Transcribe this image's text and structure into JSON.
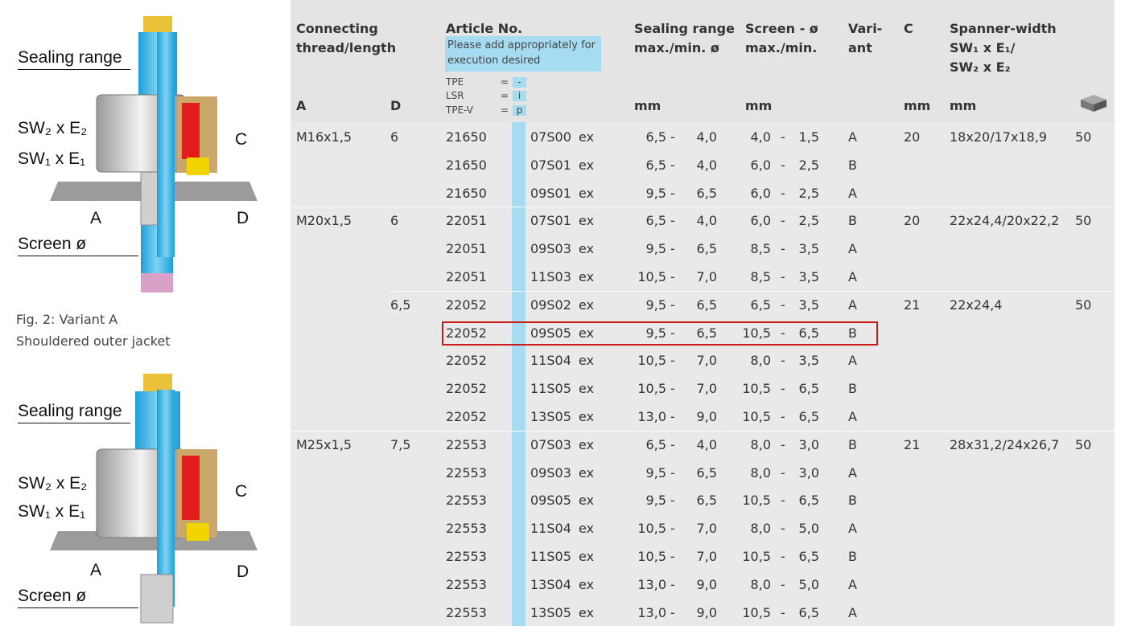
{
  "figure_labels": {
    "sealing_range": "Sealing range",
    "sw2": "SW₂ x E₂",
    "sw1": "SW₁ x E₁",
    "c": "C",
    "d": "D",
    "a": "A",
    "screen": "Screen ø"
  },
  "caption": {
    "line1": "Fig. 2: Variant A",
    "line2": "Shouldered outer jacket"
  },
  "colors": {
    "accent_blue": "#a6dcf2",
    "highlight_red": "#cc1a1a"
  },
  "table": {
    "headers": {
      "connecting": [
        "Connecting",
        "thread/length"
      ],
      "article": "Article No.",
      "note": "Please add appropriately for execution desired",
      "codes": [
        {
          "name": "TPE",
          "eq": "=",
          "val": "-"
        },
        {
          "name": "LSR",
          "eq": "=",
          "val": "i"
        },
        {
          "name": "TPE-V",
          "eq": "=",
          "val": "p"
        }
      ],
      "sealing": [
        "Sealing range",
        "max./min. ø"
      ],
      "screen": [
        "Screen - ø",
        "max./min."
      ],
      "variant": [
        "Vari-",
        "ant"
      ],
      "c": "C",
      "spanner": [
        "Spanner-width",
        "SW₁ x E₁/",
        "SW₂ x E₂"
      ],
      "sub_a": "A",
      "sub_d": "D",
      "sub_mm1": "mm",
      "sub_mm2": "mm",
      "sub_mm3": "mm",
      "sub_mm4": "mm",
      "pack_icon": "package-icon"
    },
    "rows": [
      {
        "a": "M16x1,5",
        "d": "6",
        "art": "21650",
        "code": "07S00",
        "ex": "ex",
        "smax": "6,5",
        "smin": "4,0",
        "rmax": "4,0",
        "rmin": "1,5",
        "var": "A",
        "c": "20",
        "sw": "18x20/17x18,9",
        "qty": "50"
      },
      {
        "a": "",
        "d": "",
        "art": "21650",
        "code": "07S01",
        "ex": "ex",
        "smax": "6,5",
        "smin": "4,0",
        "rmax": "6,0",
        "rmin": "2,5",
        "var": "B",
        "c": "",
        "sw": "",
        "qty": ""
      },
      {
        "a": "",
        "d": "",
        "art": "21650",
        "code": "09S01",
        "ex": "ex",
        "smax": "9,5",
        "smin": "6,5",
        "rmax": "6,0",
        "rmin": "2,5",
        "var": "A",
        "c": "",
        "sw": "",
        "qty": ""
      },
      {
        "a": "M20x1,5",
        "d": "6",
        "art": "22051",
        "code": "07S01",
        "ex": "ex",
        "smax": "6,5",
        "smin": "4,0",
        "rmax": "6,0",
        "rmin": "2,5",
        "var": "B",
        "c": "20",
        "sw": "22x24,4/20x22,2",
        "qty": "50"
      },
      {
        "a": "",
        "d": "",
        "art": "22051",
        "code": "09S03",
        "ex": "ex",
        "smax": "9,5",
        "smin": "6,5",
        "rmax": "8,5",
        "rmin": "3,5",
        "var": "A",
        "c": "",
        "sw": "",
        "qty": ""
      },
      {
        "a": "",
        "d": "",
        "art": "22051",
        "code": "11S03",
        "ex": "ex",
        "smax": "10,5",
        "smin": "7,0",
        "rmax": "8,5",
        "rmin": "3,5",
        "var": "A",
        "c": "",
        "sw": "",
        "qty": ""
      },
      {
        "a": "",
        "d": "6,5",
        "art": "22052",
        "code": "09S02",
        "ex": "ex",
        "smax": "9,5",
        "smin": "6,5",
        "rmax": "6,5",
        "rmin": "3,5",
        "var": "A",
        "c": "21",
        "sw": "22x24,4",
        "qty": "50"
      },
      {
        "a": "",
        "d": "",
        "art": "22052",
        "code": "09S05",
        "ex": "ex",
        "smax": "9,5",
        "smin": "6,5",
        "rmax": "10,5",
        "rmin": "6,5",
        "var": "B",
        "c": "",
        "sw": "",
        "qty": ""
      },
      {
        "a": "",
        "d": "",
        "art": "22052",
        "code": "11S04",
        "ex": "ex",
        "smax": "10,5",
        "smin": "7,0",
        "rmax": "8,0",
        "rmin": "3,5",
        "var": "A",
        "c": "",
        "sw": "",
        "qty": ""
      },
      {
        "a": "",
        "d": "",
        "art": "22052",
        "code": "11S05",
        "ex": "ex",
        "smax": "10,5",
        "smin": "7,0",
        "rmax": "10,5",
        "rmin": "6,5",
        "var": "B",
        "c": "",
        "sw": "",
        "qty": ""
      },
      {
        "a": "",
        "d": "",
        "art": "22052",
        "code": "13S05",
        "ex": "ex",
        "smax": "13,0",
        "smin": "9,0",
        "rmax": "10,5",
        "rmin": "6,5",
        "var": "A",
        "c": "",
        "sw": "",
        "qty": ""
      },
      {
        "a": "M25x1,5",
        "d": "7,5",
        "art": "22553",
        "code": "07S03",
        "ex": "ex",
        "smax": "6,5",
        "smin": "4,0",
        "rmax": "8,0",
        "rmin": "3,0",
        "var": "B",
        "c": "21",
        "sw": "28x31,2/24x26,7",
        "qty": "50"
      },
      {
        "a": "",
        "d": "",
        "art": "22553",
        "code": "09S03",
        "ex": "ex",
        "smax": "9,5",
        "smin": "6,5",
        "rmax": "8,0",
        "rmin": "3,0",
        "var": "A",
        "c": "",
        "sw": "",
        "qty": ""
      },
      {
        "a": "",
        "d": "",
        "art": "22553",
        "code": "09S05",
        "ex": "ex",
        "smax": "9,5",
        "smin": "6,5",
        "rmax": "10,5",
        "rmin": "6,5",
        "var": "B",
        "c": "",
        "sw": "",
        "qty": ""
      },
      {
        "a": "",
        "d": "",
        "art": "22553",
        "code": "11S04",
        "ex": "ex",
        "smax": "10,5",
        "smin": "7,0",
        "rmax": "8,0",
        "rmin": "5,0",
        "var": "A",
        "c": "",
        "sw": "",
        "qty": ""
      },
      {
        "a": "",
        "d": "",
        "art": "22553",
        "code": "11S05",
        "ex": "ex",
        "smax": "10,5",
        "smin": "7,0",
        "rmax": "10,5",
        "rmin": "6,5",
        "var": "B",
        "c": "",
        "sw": "",
        "qty": ""
      },
      {
        "a": "",
        "d": "",
        "art": "22553",
        "code": "13S04",
        "ex": "ex",
        "smax": "13,0",
        "smin": "9,0",
        "rmax": "8,0",
        "rmin": "5,0",
        "var": "A",
        "c": "",
        "sw": "",
        "qty": ""
      },
      {
        "a": "",
        "d": "",
        "art": "22553",
        "code": "13S05",
        "ex": "ex",
        "smax": "13,0",
        "smin": "9,0",
        "rmax": "10,5",
        "rmin": "6,5",
        "var": "A",
        "c": "",
        "sw": "",
        "qty": ""
      }
    ]
  }
}
